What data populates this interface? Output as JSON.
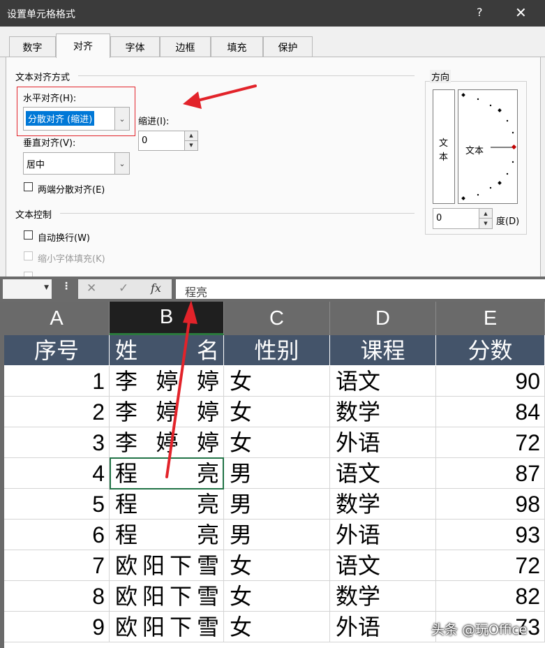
{
  "dialog": {
    "title": "设置单元格格式",
    "help_label": "?",
    "close_label": "✕",
    "tabs": [
      "数字",
      "对齐",
      "字体",
      "边框",
      "填充",
      "保护"
    ],
    "active_tab": "对齐",
    "alignment": {
      "section_label": "文本对齐方式",
      "horizontal_label": "水平对齐(H):",
      "horizontal_value": "分散对齐 (缩进)",
      "indent_label": "缩进(I):",
      "indent_value": "0",
      "vertical_label": "垂直对齐(V):",
      "vertical_value": "居中",
      "justify_distributed_label": "两端分散对齐(E)"
    },
    "text_control": {
      "section_label": "文本控制",
      "wrap_text_label": "自动换行(W)",
      "shrink_to_fit_label": "缩小字体填充(K)"
    },
    "orientation": {
      "section_label": "方向",
      "vertical_text": [
        "文",
        "本"
      ],
      "dial_text": "文本",
      "degree_value": "0",
      "degree_label": "度(D)"
    }
  },
  "formula_bar": {
    "name_box": "",
    "cancel_icon": "✕",
    "enter_icon": "✓",
    "fx_label": "fx",
    "content": "程亮"
  },
  "sheet": {
    "columns": [
      "A",
      "B",
      "C",
      "D",
      "E"
    ],
    "selected_column": "B",
    "header": [
      "序号",
      "姓",
      "名",
      "性别",
      "课程",
      "分数"
    ],
    "rows": [
      {
        "no": "1",
        "name": [
          "李",
          "婷",
          "婷"
        ],
        "gender": "女",
        "course": "语文",
        "score": "90"
      },
      {
        "no": "2",
        "name": [
          "李",
          "婷",
          "婷"
        ],
        "gender": "女",
        "course": "数学",
        "score": "84"
      },
      {
        "no": "3",
        "name": [
          "李",
          "婷",
          "婷"
        ],
        "gender": "女",
        "course": "外语",
        "score": "72"
      },
      {
        "no": "4",
        "name": [
          "程",
          "亮"
        ],
        "gender": "男",
        "course": "语文",
        "score": "87"
      },
      {
        "no": "5",
        "name": [
          "程",
          "亮"
        ],
        "gender": "男",
        "course": "数学",
        "score": "98"
      },
      {
        "no": "6",
        "name": [
          "程",
          "亮"
        ],
        "gender": "男",
        "course": "外语",
        "score": "93"
      },
      {
        "no": "7",
        "name": [
          "欧",
          "阳",
          "下",
          "雪"
        ],
        "gender": "女",
        "course": "语文",
        "score": "72"
      },
      {
        "no": "8",
        "name": [
          "欧",
          "阳",
          "下",
          "雪"
        ],
        "gender": "女",
        "course": "数学",
        "score": "82"
      },
      {
        "no": "9",
        "name": [
          "欧",
          "阳",
          "下",
          "雪"
        ],
        "gender": "女",
        "course": "外语",
        "score": "73"
      }
    ]
  },
  "watermark": "头条 @玩Office",
  "colors": {
    "title_bar": "#3b3b3b",
    "header_fill": "#44546a",
    "annotation_red": "#e2232a",
    "selection_blue": "#0078d7",
    "active_cell_green": "#217346"
  }
}
